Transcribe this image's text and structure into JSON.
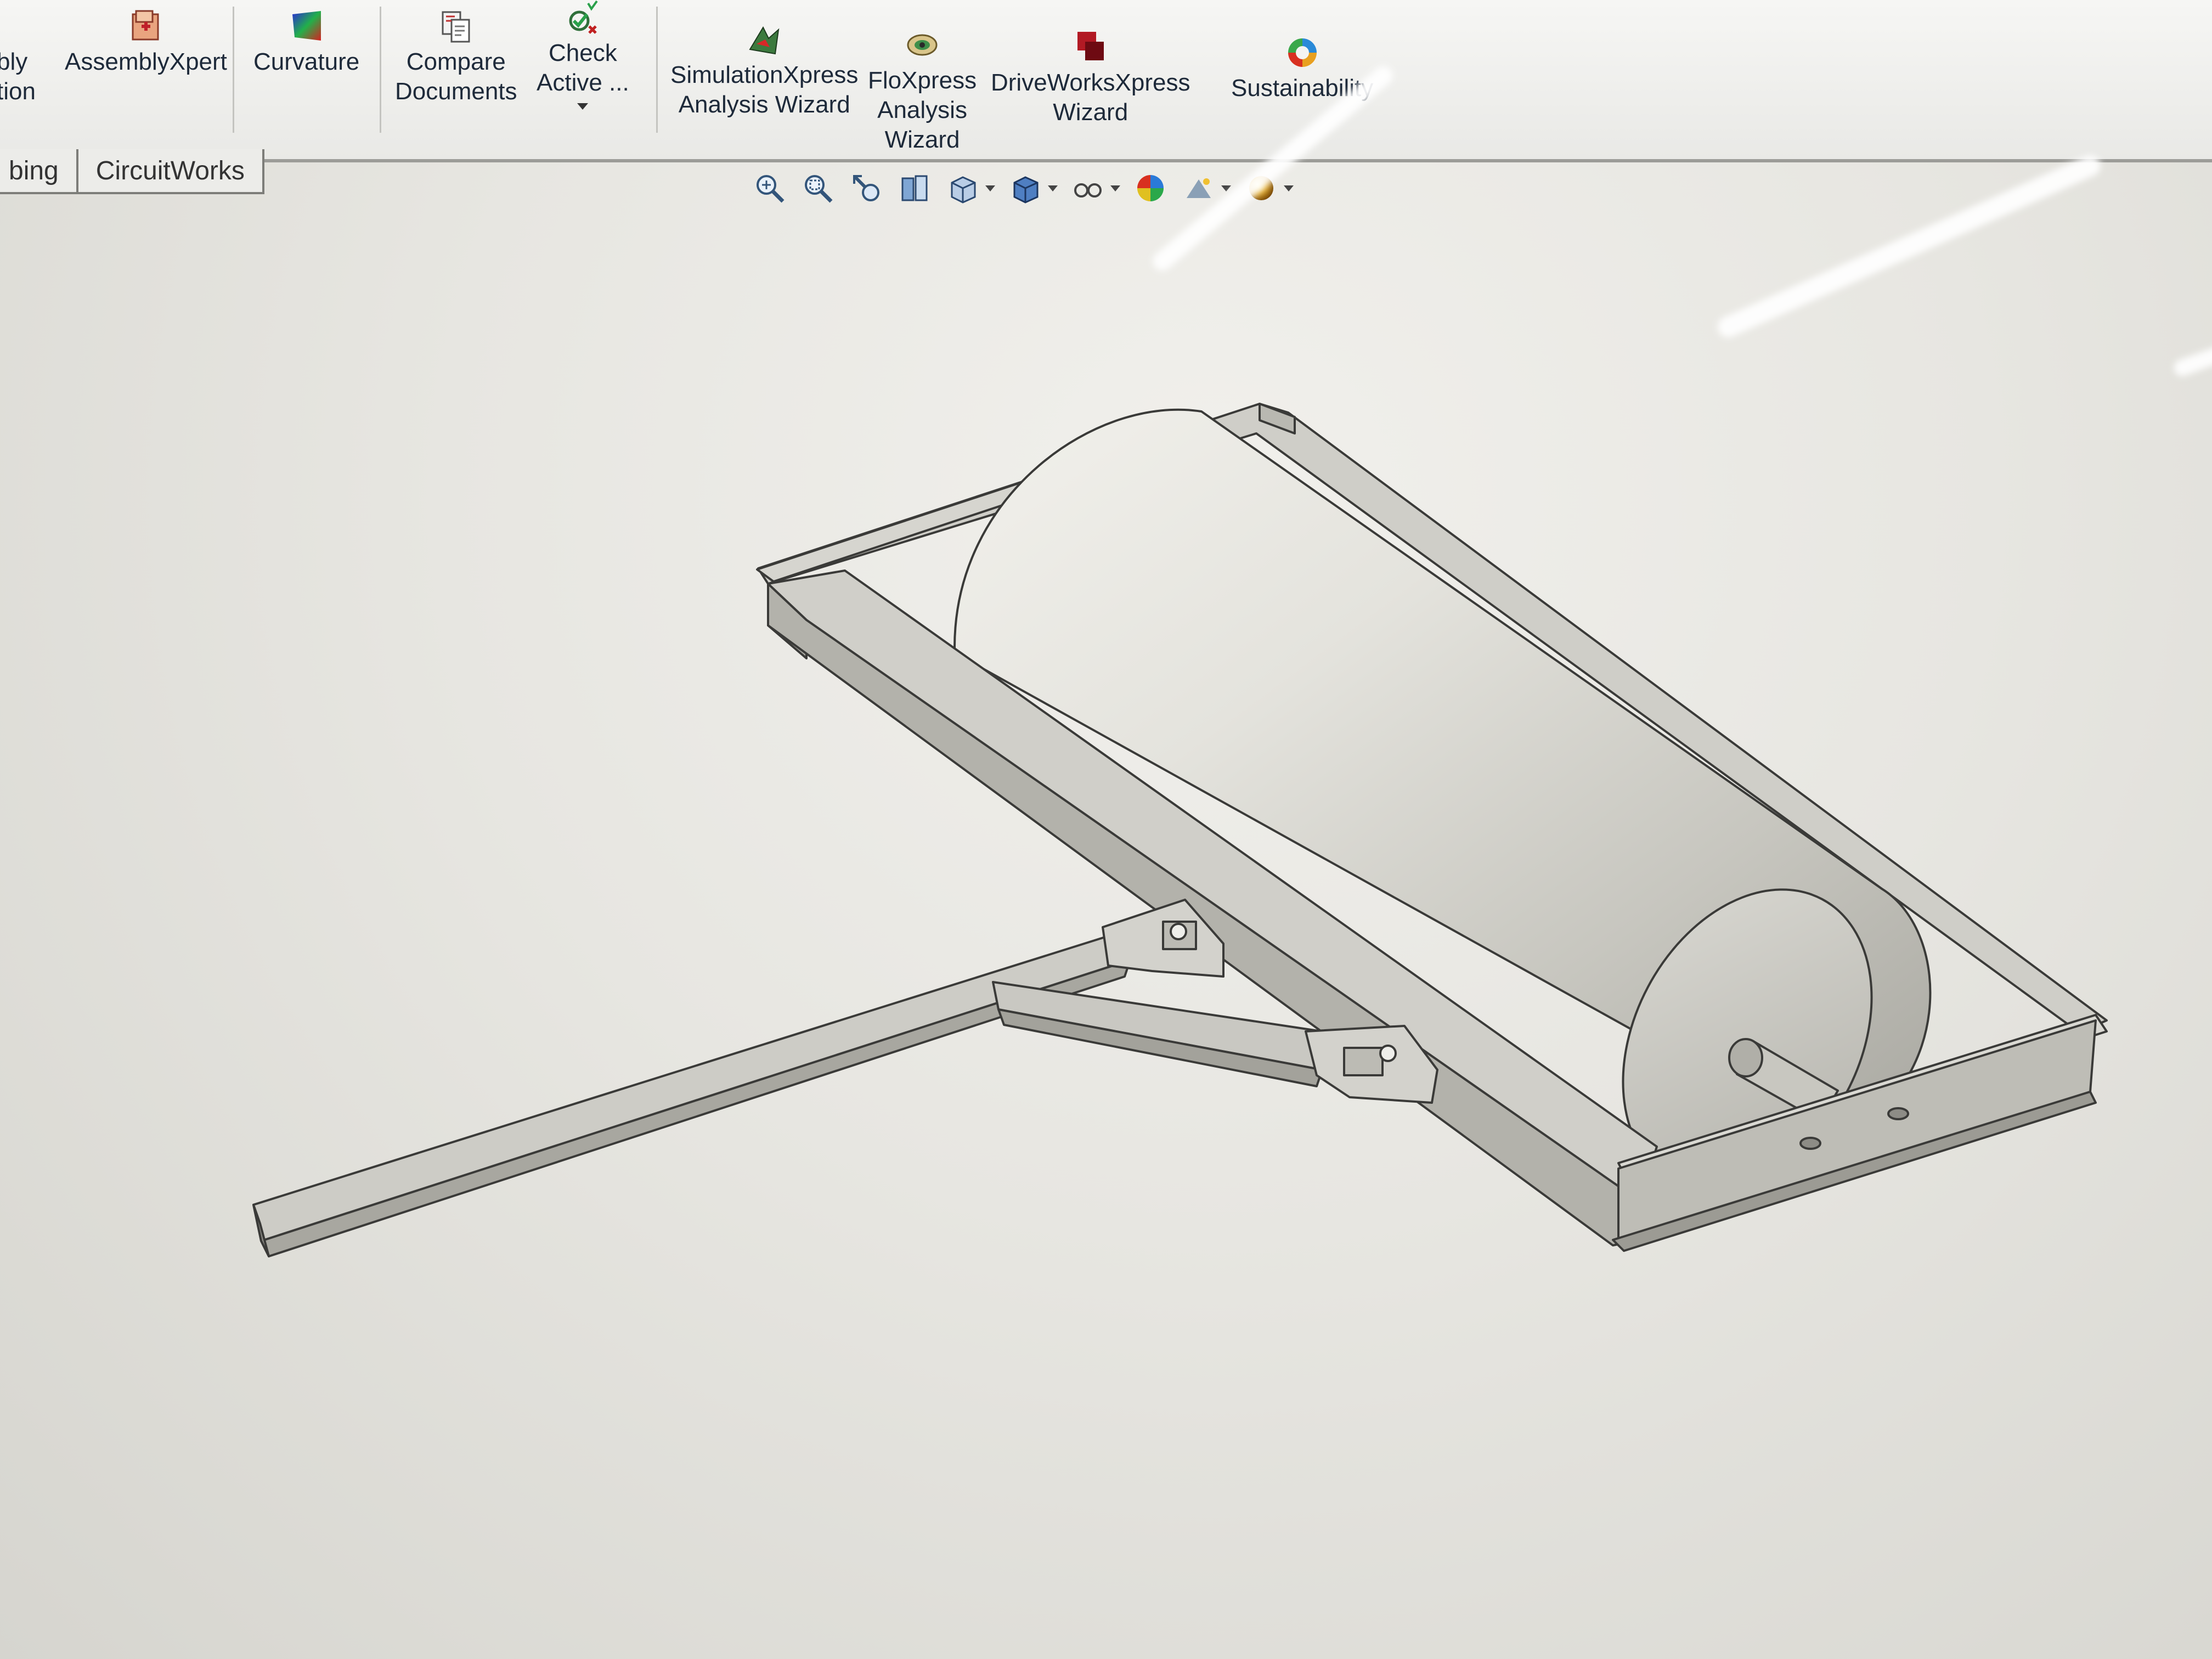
{
  "ribbon": {
    "partial_left_top": "bly",
    "partial_left_bottom": "tion",
    "commands": [
      {
        "label_1": "AssemblyXpert",
        "label_2": "",
        "icon": "assemblyxpert-icon"
      },
      {
        "label_1": "Curvature",
        "label_2": "",
        "icon": "curvature-icon"
      },
      {
        "label_1": "Compare",
        "label_2": "Documents",
        "icon": "compare-documents-icon"
      },
      {
        "label_1": "Check",
        "label_2": "Active ...",
        "icon": "check-active-icon"
      },
      {
        "label_1": "SimulationXpress",
        "label_2": "Analysis Wizard",
        "icon": "simulationxpress-icon"
      },
      {
        "label_1": "FloXpress",
        "label_2": "Analysis",
        "label_3": "Wizard",
        "icon": "floxpress-icon"
      },
      {
        "label_1": "DriveWorksXpress",
        "label_2": "Wizard",
        "icon": "driveworksxpress-icon"
      },
      {
        "label_1": "Sustainability",
        "label_2": "",
        "icon": "sustainability-icon"
      }
    ]
  },
  "tabs": [
    {
      "label": "bing"
    },
    {
      "label": "CircuitWorks"
    }
  ],
  "viewbar": {
    "icons": [
      "zoom-to-fit-icon",
      "zoom-to-area-icon",
      "previous-view-icon",
      "section-view-icon",
      "view-orientation-icon",
      "display-style-icon",
      "hide-show-items-icon",
      "edit-appearance-icon",
      "apply-scene-icon",
      "view-settings-icon"
    ]
  },
  "colors": {
    "ribbon_text": "#1e2a3a",
    "model_face_light": "#d9d8d2",
    "model_face_mid": "#c4c3bc",
    "model_face_dark": "#9f9e97",
    "model_edge": "#3a3a38",
    "viewport_bg": "#e7e6e1"
  }
}
